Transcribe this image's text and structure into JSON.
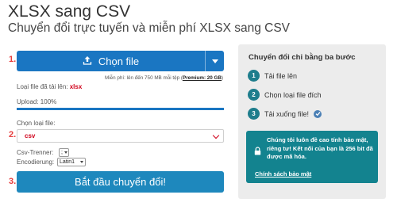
{
  "page": {
    "title": "XLSX sang CSV",
    "subtitle": "Chuyển đổi trực tuyến và miễn phí XLSX sang CSV"
  },
  "steps_markers": [
    "1.",
    "2.",
    "3."
  ],
  "upload": {
    "button_label": "Chọn file",
    "limit_note_prefix": "Miễn phí: lên đến 750 MB mỗi tệp (",
    "limit_note_link": "Premium: 20 GB",
    "limit_note_suffix": ")",
    "uploaded_label": "Loại file đã tải lên:",
    "uploaded_ext": "xlsx",
    "progress_label": "Upload: 100%",
    "progress": 1.0
  },
  "convert": {
    "select_label": "Chọn loại file:",
    "selected_format": "csv",
    "csv_sep_label": "Csv-Trenner:",
    "csv_sep_value": ";",
    "encoding_label": "Encodierung:",
    "encoding_value": "Latin1",
    "start_button": "Bắt đầu chuyển đổi!"
  },
  "sidebar": {
    "title": "Chuyển đổi chỉ bằng ba bước",
    "steps": [
      {
        "num": "1",
        "text": "Tải file lên"
      },
      {
        "num": "2",
        "text": "Chọn loại file đích"
      },
      {
        "num": "3",
        "text": "Tải xuống file!"
      }
    ],
    "security_text": "Chúng tôi luôn đề cao tính bảo mật, riêng tư! Kết nối của bạn là 256 bit đã được mã hóa.",
    "privacy_link": "Chính sách bảo mật"
  },
  "colors": {
    "primary_blue": "#1a76c2",
    "start_blue": "#1e88bd",
    "teal": "#13838f",
    "step_teal": "#1e7d8c",
    "red": "#d0021b",
    "panel_bg": "#ececec"
  },
  "icons": [
    "upload-icon",
    "chevron-down-icon",
    "check-icon",
    "lock-icon"
  ]
}
